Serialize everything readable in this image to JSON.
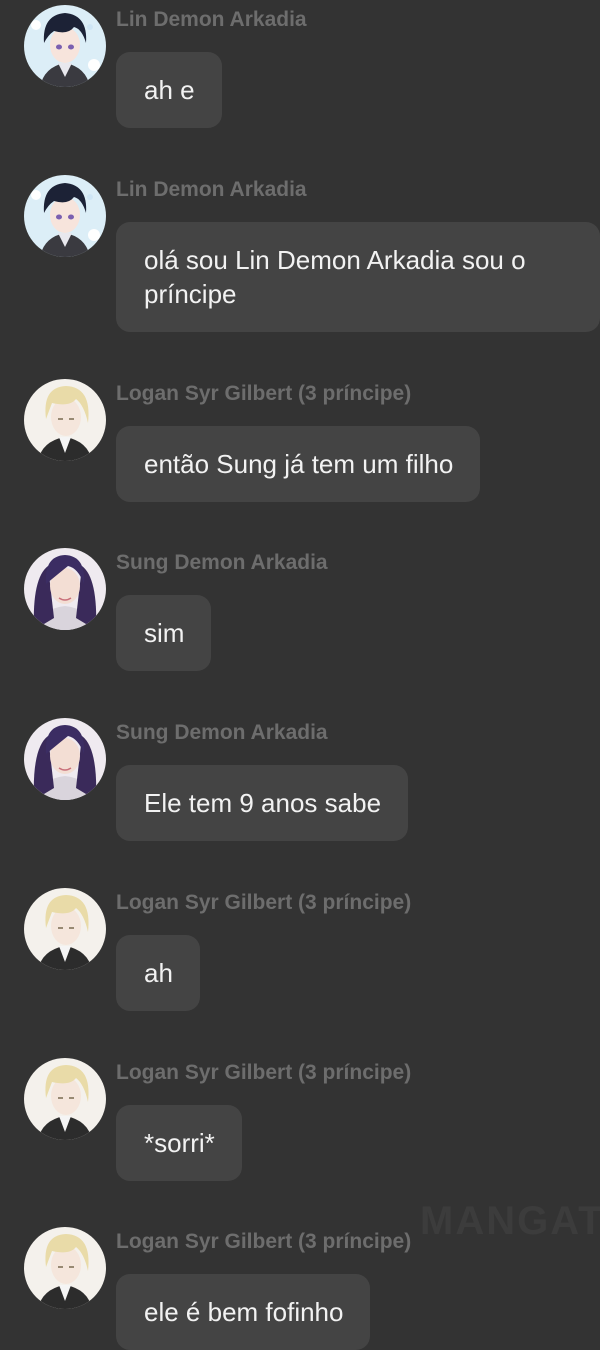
{
  "messages": [
    {
      "sender": "Lin Demon Arkadia",
      "avatar": "lin-avatar",
      "text": "ah e"
    },
    {
      "sender": "Lin Demon Arkadia",
      "avatar": "lin-avatar",
      "text": "olá sou Lin Demon Arkadia sou o príncipe"
    },
    {
      "sender": "Logan Syr Gilbert (3 príncipe)",
      "avatar": "logan-avatar",
      "text": "então Sung já tem um filho"
    },
    {
      "sender": "Sung Demon Arkadia",
      "avatar": "sung-avatar",
      "text": "sim"
    },
    {
      "sender": "Sung Demon Arkadia",
      "avatar": "sung-avatar",
      "text": "Ele tem 9 anos sabe"
    },
    {
      "sender": "Logan Syr Gilbert (3 príncipe)",
      "avatar": "logan-avatar",
      "text": "ah"
    },
    {
      "sender": "Logan Syr Gilbert (3 príncipe)",
      "avatar": "logan-avatar",
      "text": "*sorri*"
    },
    {
      "sender": "Logan Syr Gilbert (3 príncipe)",
      "avatar": "logan-avatar",
      "text": "ele é bem fofinho"
    }
  ],
  "watermark": "MANGATO"
}
